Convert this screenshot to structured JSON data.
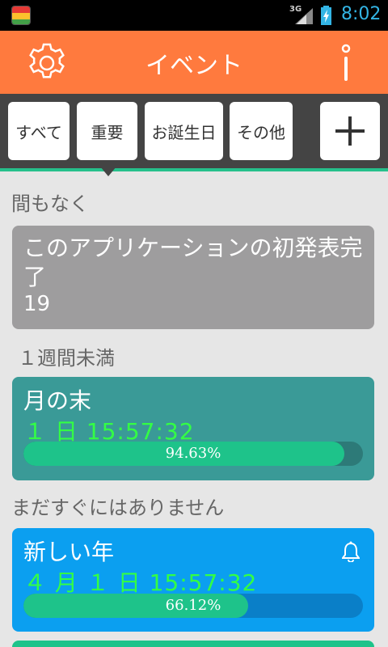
{
  "status_bar": {
    "network": "3G",
    "time": "8:02"
  },
  "app_bar": {
    "title": "イベント",
    "settings_icon": "gear-icon",
    "info_icon": "info-icon"
  },
  "tabs": [
    {
      "label": "すべて"
    },
    {
      "label": "重要"
    },
    {
      "label": "お誕生日"
    },
    {
      "label": "その他"
    }
  ],
  "add_tab_icon": "plus-icon",
  "sections": {
    "soon": "間もなく",
    "within_week": "１週間未満",
    "not_soon": "まだすぐにはありません"
  },
  "events": [
    {
      "name": "このアプリケーションの初発表完了",
      "subtitle": "19",
      "color": "#9e9d9e"
    },
    {
      "name": "月の末",
      "countdown": "１ 日  15:57:32",
      "progress_text": "94.63%",
      "progress": 0.9463,
      "color": "#3a9a97"
    },
    {
      "name": "新しい年",
      "countdown": "４ 月 １ 日  15:57:32",
      "progress_text": "66.12%",
      "progress": 0.6612,
      "color": "#0b9ff0",
      "reminder_icon": "bell-icon"
    }
  ],
  "colors": {
    "accent": "#ff7a3e",
    "tab_strip": "#444444",
    "progress_fill": "#1ec38a",
    "countdown_text": "#33ff44"
  }
}
